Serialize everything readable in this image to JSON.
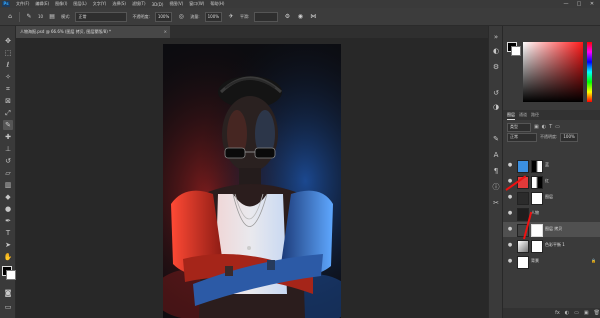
{
  "app": {
    "logo_label": "Ps"
  },
  "menu": [
    "文件(F)",
    "编辑(E)",
    "图像(I)",
    "图层(L)",
    "文字(Y)",
    "选择(S)",
    "滤镜(T)",
    "3D(D)",
    "视图(V)",
    "窗口(W)",
    "帮助(H)"
  ],
  "window_controls": [
    "—",
    "□",
    "✕"
  ],
  "options": {
    "brush_size": "10",
    "mode_label": "模式:",
    "mode_value": "正常",
    "opacity_label": "不透明度:",
    "opacity_value": "100%",
    "flow_label": "流量:",
    "flow_value": "100%",
    "smooth_label": "平滑:"
  },
  "document_tab": {
    "title": "人物海报.psd @ 66.6% (图层 拷贝, 图层蒙版/8) *",
    "close": "×"
  },
  "layers_panel": {
    "tabs": [
      "图层",
      "通道",
      "路径"
    ],
    "kind_label": "类型",
    "blend_label": "正常",
    "opacity_label": "不透明度:",
    "opacity_value": "100%",
    "fill_label": "填充:",
    "fill_value": "100%",
    "layers": [
      {
        "name": "蓝",
        "thumb_color": "#3b8fe0"
      },
      {
        "name": "红",
        "thumb_color": "#e23a3a"
      },
      {
        "name": "图层",
        "thumb_color": "#2b2b2b"
      },
      {
        "name": "人物",
        "thumb_color": "#1e1e1e"
      },
      {
        "name": "图层 拷贝",
        "thumb_color": "#444444"
      },
      {
        "name": "色彩平衡 1",
        "thumb_color": "#ffffff"
      },
      {
        "name": "背景",
        "thumb_color": "#ffffff"
      }
    ],
    "bottom_tools": [
      "fx",
      "◐",
      "▭",
      "▣",
      "🗑"
    ]
  },
  "colors": {
    "accent_red": "#e11111",
    "blue_glow": "#2a6fd6",
    "red_glow": "#d63b2a"
  }
}
